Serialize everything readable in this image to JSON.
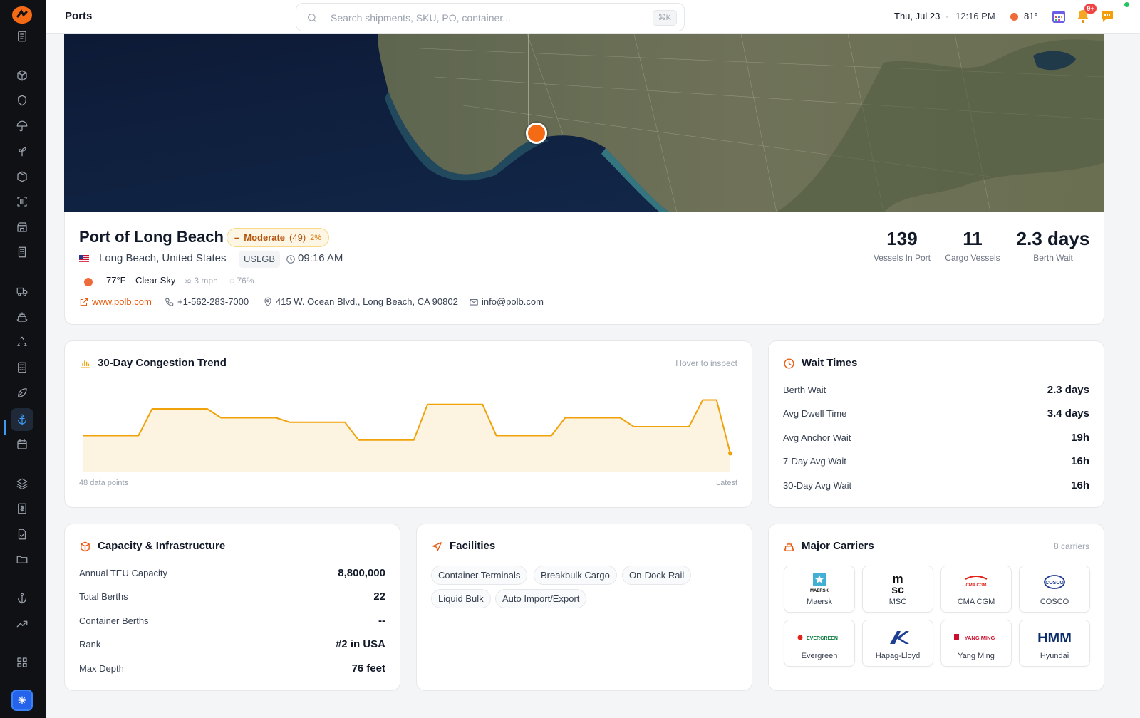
{
  "topbar": {
    "title": "Ports",
    "search_placeholder": "Search shipments, SKU, PO, container...",
    "shortcut": "⌘K",
    "date": "Thu, Jul 23",
    "time": "12:16 PM",
    "temp": "81°",
    "notification_count": "9+"
  },
  "sidebar": {
    "items": [
      "document-icon",
      "box-icon",
      "shield-icon",
      "umbrella-icon",
      "sprout-icon",
      "package-icon",
      "scan-icon",
      "store-icon",
      "building-icon",
      "truck-icon",
      "ship-icon",
      "recycle-icon",
      "calculator-icon",
      "leaf-icon",
      "anchor-icon",
      "calendar-icon",
      "layers-icon",
      "receipt-icon",
      "file-check-icon",
      "folder-icon",
      "anchor-icon",
      "trend-icon",
      "grid-icon"
    ],
    "active": "anchor-icon",
    "accent": "#3b9bf6"
  },
  "port": {
    "name": "Port of Long Beach",
    "status": {
      "dash": "–",
      "level": "Moderate",
      "score": "(49)",
      "change": "2%"
    },
    "location": "Long Beach, United States",
    "code": "USLGB",
    "local_time": "09:16 AM",
    "weather": {
      "temp": "77°F",
      "condition": "Clear Sky",
      "wind": "3 mph",
      "humidity": "76%"
    },
    "website": "www.polb.com",
    "phone": "+1-562-283-7000",
    "address": "415 W. Ocean Blvd., Long Beach, CA 90802",
    "email": "info@polb.com",
    "stats": [
      {
        "value": "139",
        "label": "Vessels In Port"
      },
      {
        "value": "11",
        "label": "Cargo Vessels"
      },
      {
        "value": "2.3 days",
        "label": "Berth Wait"
      }
    ]
  },
  "trend": {
    "title": "30-Day Congestion Trend",
    "hint": "Hover to inspect",
    "footer_left": "48 data points",
    "footer_right": "Latest",
    "color": "#f0a20a"
  },
  "chart_data": {
    "type": "area",
    "title": "30-Day Congestion Trend",
    "x": [
      0,
      1,
      2,
      3,
      4,
      5,
      6,
      7,
      8,
      9,
      10,
      11,
      12,
      13,
      14,
      15,
      16,
      17,
      18,
      19,
      20,
      21,
      22,
      23,
      24,
      25,
      26,
      27,
      28,
      29,
      30,
      31,
      32,
      33,
      34,
      35,
      36,
      37,
      38,
      39,
      40,
      41,
      42,
      43,
      44,
      45,
      46,
      47
    ],
    "series": [
      {
        "values": [
          42,
          42,
          42,
          42,
          42,
          48,
          48,
          48,
          48,
          48,
          46,
          46,
          46,
          46,
          46,
          45,
          45,
          45,
          45,
          45,
          41,
          41,
          41,
          41,
          41,
          49,
          49,
          49,
          49,
          49,
          42,
          42,
          42,
          42,
          42,
          46,
          46,
          46,
          46,
          46,
          44,
          44,
          44,
          44,
          44,
          50,
          50,
          50
        ]
      }
    ],
    "notes": "last segment drops to 38 at final point",
    "grid": false,
    "legend": "none"
  },
  "wait": {
    "title": "Wait Times",
    "rows": [
      {
        "label": "Berth Wait",
        "value": "2.3 days"
      },
      {
        "label": "Avg Dwell Time",
        "value": "3.4 days"
      },
      {
        "label": "Avg Anchor Wait",
        "value": "19h"
      },
      {
        "label": "7-Day Avg Wait",
        "value": "16h"
      },
      {
        "label": "30-Day Avg Wait",
        "value": "16h"
      }
    ]
  },
  "capacity": {
    "title": "Capacity & Infrastructure",
    "rows": [
      {
        "label": "Annual TEU Capacity",
        "value": "8,800,000"
      },
      {
        "label": "Total Berths",
        "value": "22"
      },
      {
        "label": "Container Berths",
        "value": "--"
      },
      {
        "label": "Rank",
        "value": "#2 in USA"
      },
      {
        "label": "Max Depth",
        "value": "76 feet"
      }
    ]
  },
  "facilities": {
    "title": "Facilities",
    "tags": [
      "Container Terminals",
      "Breakbulk Cargo",
      "On-Dock Rail",
      "Liquid Bulk",
      "Auto Import/Export"
    ]
  },
  "carriers": {
    "title": "Major Carriers",
    "count": "8 carriers",
    "items": [
      {
        "name": "Maersk",
        "logo_text": "MAERSK",
        "color": "#42b0d5"
      },
      {
        "name": "MSC",
        "logo_text": "msc",
        "color": "#111111"
      },
      {
        "name": "CMA CGM",
        "logo_text": "CMA CGM",
        "color": "#e2231a"
      },
      {
        "name": "COSCO",
        "logo_text": "COSCO",
        "color": "#1f3a93"
      },
      {
        "name": "Evergreen",
        "logo_text": "EVERGREEN",
        "color": "#0a7d3e"
      },
      {
        "name": "Hapag-Lloyd",
        "logo_text": "HL",
        "color": "#1c3f94"
      },
      {
        "name": "Yang Ming",
        "logo_text": "YANG MING",
        "color": "#c8102e"
      },
      {
        "name": "Hyundai",
        "logo_text": "HMM",
        "color": "#0b2d6b"
      }
    ]
  }
}
